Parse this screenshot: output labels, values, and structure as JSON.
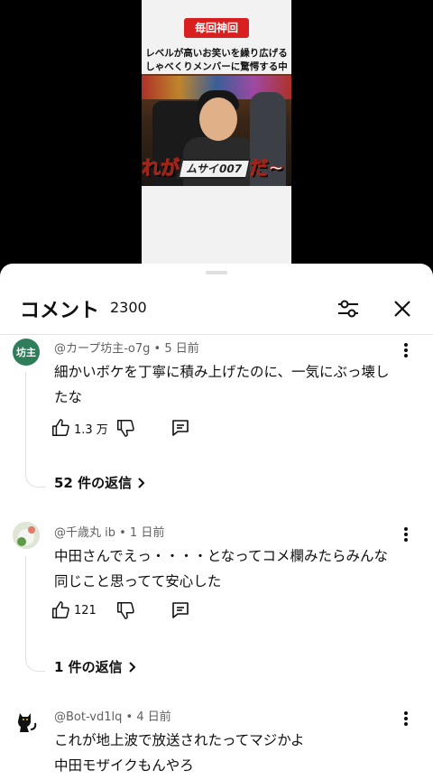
{
  "video": {
    "badge": "毎回神回",
    "headline_line1": "レベルが高いお笑いを繰り広げる",
    "headline_line2": "しゃべくりメンバーに驚愕する中田",
    "caption_left": "れが",
    "caption_logo": "ムサイ007",
    "caption_right": "だ~"
  },
  "sheet": {
    "title": "コメント",
    "count": "2300"
  },
  "icons": {
    "filter": "sliders-icon",
    "close": "close-icon",
    "like": "thumbs-up-icon",
    "dislike": "thumbs-down-icon",
    "reply": "comment-icon",
    "more": "more-vert-icon",
    "chevron": "chevron-right-icon"
  },
  "comments": [
    {
      "avatar_text": "坊主",
      "meta": "@カープ坊主-o7g • 5 日前",
      "text": "細かいボケを丁寧に積み上げたのに、一気にぶっ壊したな",
      "likes": "1.3 万",
      "replies": "52 件の返信"
    },
    {
      "avatar_text": "",
      "meta": "@千歳丸 ib • 1 日前",
      "text": "中田さんでえっ・・・・となってコメ欄みたらみんな同じこと思ってて安心した",
      "likes": "121",
      "replies": "1 件の返信"
    },
    {
      "avatar_text": "",
      "meta": "@Bot-vd1lq • 4 日前",
      "text": "これが地上波で放送されたってマジかよ\n中田モザイクもんやろ"
    }
  ],
  "colors": {
    "text": "#0f0f0f",
    "meta": "#606060",
    "avatar1_bg": "#2f7d5a",
    "badge_red": "#d82020"
  }
}
